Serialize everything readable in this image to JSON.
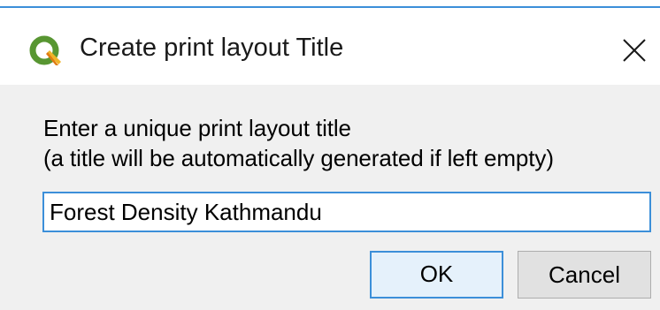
{
  "window": {
    "title": "Create print layout Title",
    "app_icon": "qgis-logo-icon",
    "close_icon": "close-icon"
  },
  "prompt": {
    "line1": "Enter a unique print layout title",
    "line2": "(a title will be automatically generated if left empty)"
  },
  "input": {
    "value": "Forest Density Kathmandu",
    "placeholder": ""
  },
  "buttons": {
    "ok_label": "OK",
    "cancel_label": "Cancel"
  },
  "colors": {
    "accent": "#3c8fd9",
    "qgis_green": "#589632",
    "qgis_yellow": "#ee7913"
  }
}
